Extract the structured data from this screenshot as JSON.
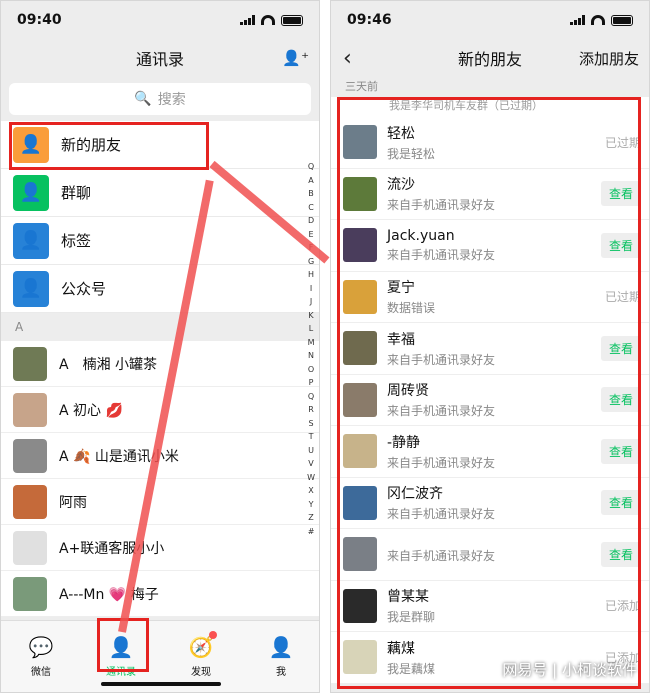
{
  "left": {
    "status_time": "09:40",
    "nav_title": "通讯录",
    "search_placeholder": "搜索",
    "menu": [
      {
        "label": "新的朋友",
        "color": "#fa9d3b",
        "icon": "add-friend-icon"
      },
      {
        "label": "群聊",
        "color": "#07c160",
        "icon": "group-chat-icon"
      },
      {
        "label": "标签",
        "color": "#2782d7",
        "icon": "tag-icon"
      },
      {
        "label": "公众号",
        "color": "#2782d7",
        "icon": "official-account-icon"
      }
    ],
    "section_a": "A",
    "contacts": [
      {
        "name": "A　楠湘 小罐茶"
      },
      {
        "name": "A 初心 💋"
      },
      {
        "name": "A 🍂 山是通讯小米"
      },
      {
        "name": "阿雨"
      },
      {
        "name": "A+联通客服小小"
      },
      {
        "name": "A---Mn 💗 梅子"
      }
    ],
    "alphabet": [
      "Q",
      "A",
      "B",
      "C",
      "D",
      "E",
      "F",
      "G",
      "H",
      "I",
      "J",
      "K",
      "L",
      "M",
      "N",
      "O",
      "P",
      "Q",
      "R",
      "S",
      "T",
      "U",
      "V",
      "W",
      "X",
      "Y",
      "Z",
      "#"
    ],
    "tabs": [
      {
        "label": "微信",
        "icon": "chat-icon"
      },
      {
        "label": "通讯录",
        "icon": "contacts-icon"
      },
      {
        "label": "发现",
        "icon": "compass-icon"
      },
      {
        "label": "我",
        "icon": "me-icon"
      }
    ]
  },
  "right": {
    "status_time": "09:46",
    "nav_title": "新的朋友",
    "nav_action": "添加朋友",
    "section": "三天前",
    "partial_row": "我是李华司机车友群（已过期）",
    "friends": [
      {
        "name": "轻松",
        "sub": "我是轻松",
        "action": "已过期",
        "type": "text",
        "color": "#6c7d8a"
      },
      {
        "name": "流沙",
        "sub": "来自手机通讯录好友",
        "action": "查看",
        "type": "button",
        "color": "#5d7a3a"
      },
      {
        "name": "Jack.yuan",
        "sub": "来自手机通讯录好友",
        "action": "查看",
        "type": "button",
        "color": "#4a3d5c"
      },
      {
        "name": "夏宁",
        "sub": "数据错误",
        "action": "已过期",
        "type": "text",
        "color": "#d9a13a"
      },
      {
        "name": "幸福",
        "sub": "来自手机通讯录好友",
        "action": "查看",
        "type": "button",
        "color": "#6f6a4e"
      },
      {
        "name": "周砖贤",
        "sub": "来自手机通讯录好友",
        "action": "查看",
        "type": "button",
        "color": "#8a7b6a"
      },
      {
        "name": "-静静",
        "sub": "来自手机通讯录好友",
        "action": "查看",
        "type": "button",
        "color": "#c7b38a"
      },
      {
        "name": "冈仁波齐",
        "sub": "来自手机通讯录好友",
        "action": "查看",
        "type": "button",
        "color": "#3d6a9a"
      },
      {
        "name": "",
        "sub": "来自手机通讯录好友",
        "action": "查看",
        "type": "button",
        "color": "#7a7f86"
      },
      {
        "name": "曾某某",
        "sub": "我是群聊",
        "action": "已添加",
        "type": "text",
        "color": "#2a2a2a"
      },
      {
        "name": "藕煤",
        "sub": "我是藕煤",
        "action": "已添加",
        "type": "text",
        "color": "#d8d4b8"
      }
    ],
    "watermark": "网易号 | 小柯谈软件"
  }
}
